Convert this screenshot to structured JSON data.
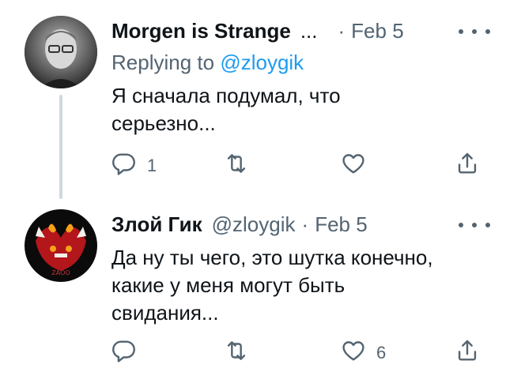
{
  "tweets": [
    {
      "display_name": "Morgen is Strange",
      "name_truncation": "...",
      "separator": "·",
      "date": "Feb 5",
      "replying_prefix": "Replying to",
      "replying_to": "@zloygik",
      "text": "Я сначала подумал, что\nсерьезно...",
      "reply_count": "1",
      "retweet_count": "",
      "like_count": ""
    },
    {
      "display_name": "Злой Гик",
      "handle": "@zloygik",
      "separator": "·",
      "date": "Feb 5",
      "text": "Да ну ты чего, это шутка конечно,\nкакие у меня могут быть\nсвидания...",
      "reply_count": "",
      "retweet_count": "",
      "like_count": "6",
      "avatar_text": "ZAOO"
    }
  ],
  "colors": {
    "text": "#0f1419",
    "secondary": "#536471",
    "link": "#1d9bf0",
    "thread_line": "#cfd9de"
  },
  "icons": [
    "reply-icon",
    "retweet-icon",
    "like-icon",
    "share-icon",
    "more-icon"
  ]
}
